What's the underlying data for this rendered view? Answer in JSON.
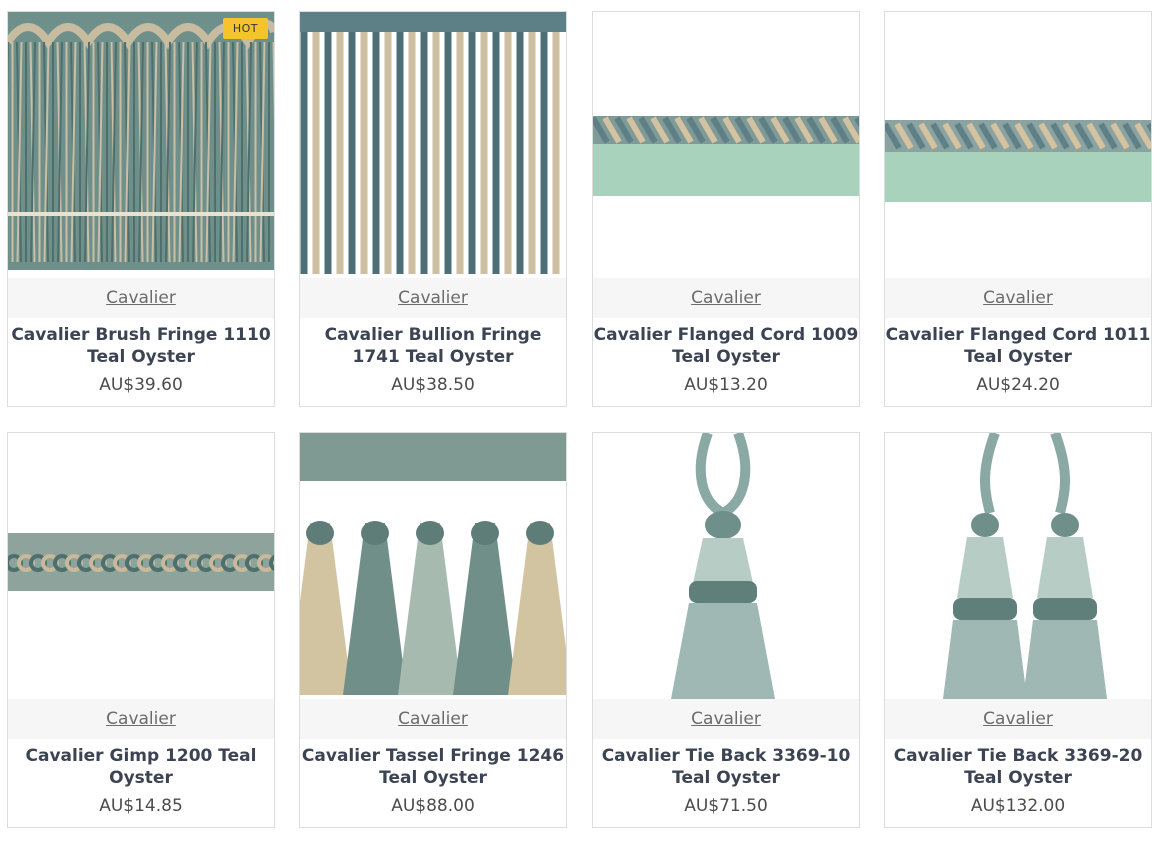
{
  "products": [
    {
      "brand": "Cavalier",
      "title": "Cavalier Brush Fringe 1110 Teal Oyster",
      "price": "AU$39.60",
      "badge": "HOT",
      "image_icon": "brush-fringe-image"
    },
    {
      "brand": "Cavalier",
      "title": "Cavalier Bullion Fringe 1741 Teal Oyster",
      "price": "AU$38.50",
      "badge": "",
      "image_icon": "bullion-fringe-image"
    },
    {
      "brand": "Cavalier",
      "title": "Cavalier Flanged Cord 1009 Teal Oyster",
      "price": "AU$13.20",
      "badge": "",
      "image_icon": "flanged-cord-image"
    },
    {
      "brand": "Cavalier",
      "title": "Cavalier Flanged Cord 1011 Teal Oyster",
      "price": "AU$24.20",
      "badge": "",
      "image_icon": "flanged-cord-image"
    },
    {
      "brand": "Cavalier",
      "title": "Cavalier Gimp 1200 Teal Oyster",
      "price": "AU$14.85",
      "badge": "",
      "image_icon": "gimp-image"
    },
    {
      "brand": "Cavalier",
      "title": "Cavalier Tassel Fringe 1246 Teal Oyster",
      "price": "AU$88.00",
      "badge": "",
      "image_icon": "tassel-fringe-image"
    },
    {
      "brand": "Cavalier",
      "title": "Cavalier Tie Back 3369-10 Teal Oyster",
      "price": "AU$71.50",
      "badge": "",
      "image_icon": "tie-back-image"
    },
    {
      "brand": "Cavalier",
      "title": "Cavalier Tie Back 3369-20 Teal Oyster",
      "price": "AU$132.00",
      "badge": "",
      "image_icon": "tie-back-double-image"
    }
  ],
  "colors": {
    "teal": "#5f8a88",
    "oyster": "#c9b99a",
    "badge": "#f5c32c",
    "brand_bar": "#f6f6f6",
    "title": "#3c4453"
  }
}
